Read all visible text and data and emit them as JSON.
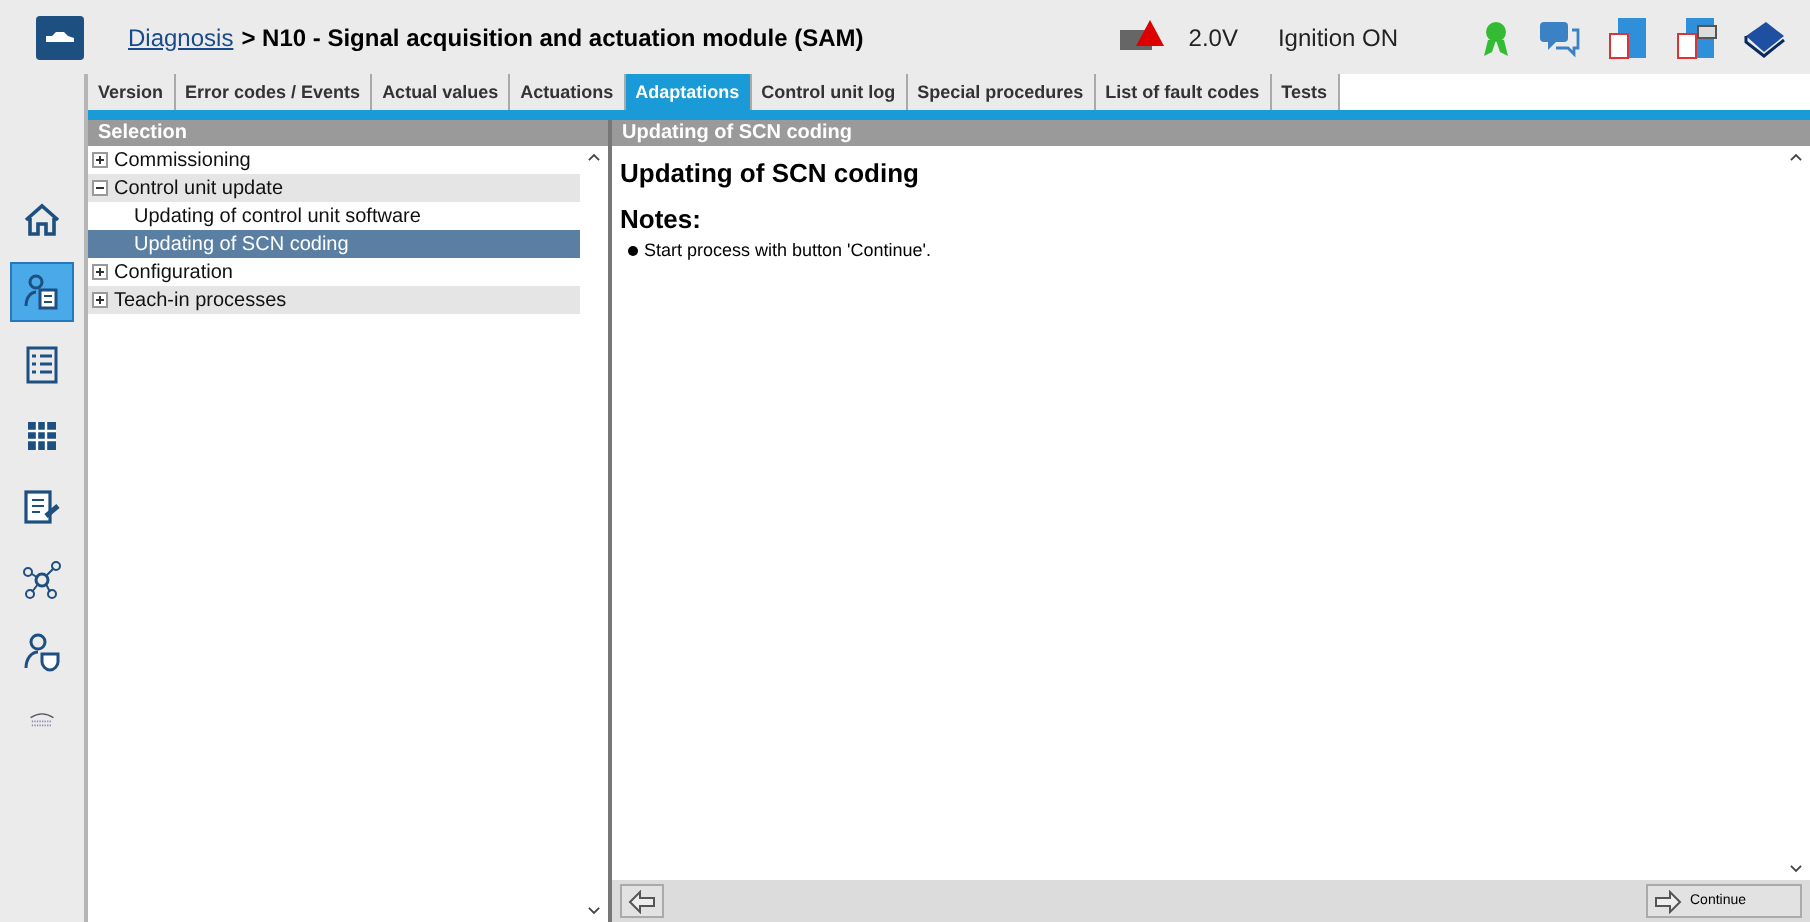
{
  "breadcrumb": {
    "link": "Diagnosis",
    "title": "> N10 - Signal acquisition and actuation module (SAM)"
  },
  "status": {
    "voltage": "2.0V",
    "ignition": "Ignition ON"
  },
  "tabs": [
    {
      "label": "Version",
      "selected": false
    },
    {
      "label": "Error codes / Events",
      "selected": false
    },
    {
      "label": "Actual values",
      "selected": false
    },
    {
      "label": "Actuations",
      "selected": false
    },
    {
      "label": "Adaptations",
      "selected": true
    },
    {
      "label": "Control unit log",
      "selected": false
    },
    {
      "label": "Special procedures",
      "selected": false
    },
    {
      "label": "List of fault codes",
      "selected": false
    },
    {
      "label": "Tests",
      "selected": false
    }
  ],
  "sidebar": {
    "items": [
      {
        "kind": "home",
        "selected": false
      },
      {
        "kind": "diagnosis",
        "selected": true
      },
      {
        "kind": "list",
        "selected": false
      },
      {
        "kind": "grid",
        "selected": false
      },
      {
        "kind": "service",
        "selected": false
      },
      {
        "kind": "network",
        "selected": false
      },
      {
        "kind": "user",
        "selected": false
      },
      {
        "kind": "remote",
        "selected": false
      }
    ]
  },
  "selection": {
    "header": "Selection",
    "items": [
      {
        "label": "Commissioning",
        "expanded": false,
        "selected": false
      },
      {
        "label": "Control unit update",
        "expanded": true,
        "selected": false,
        "children": [
          {
            "label": "Updating of control unit software",
            "selected": false
          },
          {
            "label": "Updating of SCN coding",
            "selected": true
          }
        ]
      },
      {
        "label": "Configuration",
        "expanded": false,
        "selected": false
      },
      {
        "label": "Teach-in processes",
        "expanded": false,
        "selected": false
      }
    ]
  },
  "detail": {
    "header": "Updating of SCN coding",
    "title": "Updating of SCN coding",
    "notes_label": "Notes:",
    "notes": [
      "Start process with button 'Continue'."
    ]
  },
  "buttons": {
    "continue": "Continue"
  }
}
